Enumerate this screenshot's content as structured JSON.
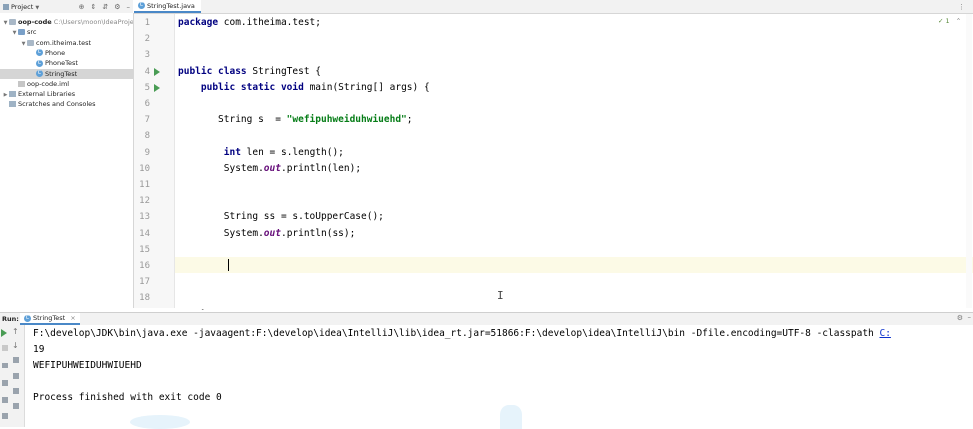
{
  "project": {
    "title": "Project",
    "tree": [
      {
        "label": "oop-code",
        "path": "C:\\Users\\moon\\IdeaProjects",
        "icon": "folder-icon",
        "indent": 0,
        "expanded": true,
        "bold": true
      },
      {
        "label": "src",
        "icon": "source-folder-icon",
        "indent": 1,
        "expanded": true
      },
      {
        "label": "com.itheima.test",
        "icon": "package-icon",
        "indent": 2,
        "expanded": true
      },
      {
        "label": "Phone",
        "icon": "class-icon",
        "indent": 3
      },
      {
        "label": "PhoneTest",
        "icon": "class-icon",
        "indent": 3
      },
      {
        "label": "StringTest",
        "icon": "class-icon",
        "indent": 3,
        "selected": true
      },
      {
        "label": "oop-code.iml",
        "icon": "iml-file-icon",
        "indent": 1
      },
      {
        "label": "External Libraries",
        "icon": "library-icon",
        "indent": 0,
        "collapsed": true
      },
      {
        "label": "Scratches and Consoles",
        "icon": "scratches-icon",
        "indent": 0
      }
    ]
  },
  "editor": {
    "tab_label": "StringTest.java",
    "inspection": "1",
    "lines": [
      {
        "n": "1",
        "html": "<span class='kw'>package</span> com.itheima.test;"
      },
      {
        "n": "2",
        "html": ""
      },
      {
        "n": "3",
        "html": ""
      },
      {
        "n": "4",
        "html": "<span class='kw'>public class</span> StringTest {",
        "run": true
      },
      {
        "n": "5",
        "html": "    <span class='kw'>public static void</span> main(String[] args) {",
        "run": true
      },
      {
        "n": "6",
        "html": ""
      },
      {
        "n": "7",
        "html": "       String s  = <span class='str'>\"wefipuhweiduhwiuehd\"</span>;"
      },
      {
        "n": "8",
        "html": ""
      },
      {
        "n": "9",
        "html": "        <span class='kw'>int</span> len = s.length();"
      },
      {
        "n": "10",
        "html": "        System.<span class='it'>out</span>.println(len);"
      },
      {
        "n": "11",
        "html": ""
      },
      {
        "n": "12",
        "html": ""
      },
      {
        "n": "13",
        "html": "        String ss = s.toUpperCase();"
      },
      {
        "n": "14",
        "html": "        System.<span class='it'>out</span>.println(ss);"
      },
      {
        "n": "15",
        "html": ""
      },
      {
        "n": "16",
        "html": ""
      },
      {
        "n": "17",
        "html": ""
      },
      {
        "n": "18",
        "html": ""
      }
    ],
    "truncated_line": "    }"
  },
  "run": {
    "label": "Run:",
    "tab_label": "StringTest",
    "output": [
      {
        "text": "F:\\develop\\JDK\\bin\\java.exe -javaagent:F:\\develop\\idea\\IntelliJ\\lib\\idea_rt.jar=51866:F:\\develop\\idea\\IntelliJ\\bin -Dfile.encoding=UTF-8 -classpath ",
        "link": "C:"
      },
      {
        "text": "19"
      },
      {
        "text": "WEFIPUHWEIDUHWIUEHD"
      },
      {
        "text": ""
      },
      {
        "text": "Process finished with exit code 0"
      }
    ]
  },
  "colors": {
    "keyword": "#000080",
    "string": "#067d17",
    "field": "#660e7a",
    "run_arrow": "#499c54",
    "current_line": "#fcfae6",
    "selection": "#d5d5d5"
  }
}
